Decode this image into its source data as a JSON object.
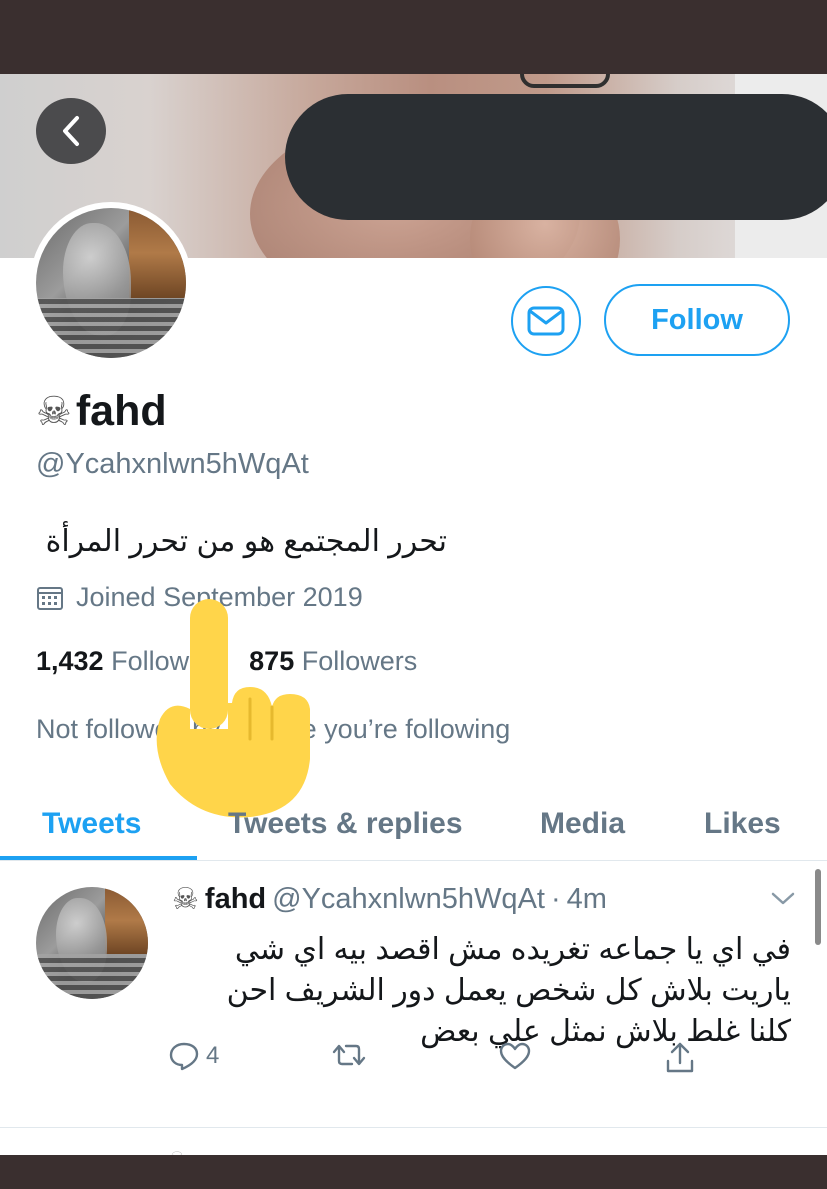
{
  "profile": {
    "name": "fahd",
    "name_icon": "skull-and-crossbones",
    "handle": "@Ycahxnlwn5hWqAt",
    "bio": "تحرر المجتمع هو من تحرر المرأة",
    "joined": "Joined September 2019",
    "following_count": "1,432",
    "following_label": "Following",
    "followers_count": "875",
    "followers_label": "Followers",
    "not_followed_text": "Not followed by anyone you’re following"
  },
  "buttons": {
    "follow_label": "Follow"
  },
  "tabs": [
    {
      "label": "Tweets"
    },
    {
      "label": "Tweets & replies"
    },
    {
      "label": "Media"
    },
    {
      "label": "Likes"
    }
  ],
  "tweet": {
    "name": "fahd",
    "handle": "@Ycahxnlwn5hWqAt",
    "separator": "·",
    "time": "4m",
    "lines": [
      "في اي يا جماعه تغريده مش اقصد بيه اي شي",
      "ياريت بلاش كل شخص يعمل دور الشريف احن",
      "كلنا غلط بلاش نمثل علي بعض"
    ],
    "reply_count": "4"
  },
  "colors": {
    "accent": "#1da1f2",
    "text_primary": "#14171a",
    "text_secondary": "#657786",
    "redaction": "#2b2f33",
    "frame": "#3a2f2f",
    "pointer_hand": "#ffd54a"
  }
}
